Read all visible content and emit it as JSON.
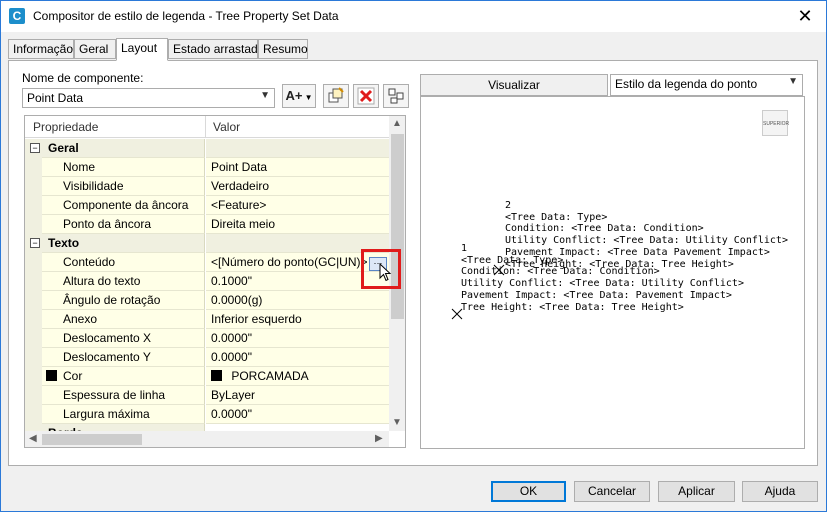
{
  "window": {
    "app_icon": "C",
    "title": "Compositor de estilo de legenda - Tree Property Set Data"
  },
  "tabs": [
    {
      "label": "Informação"
    },
    {
      "label": "Geral"
    },
    {
      "label": "Layout"
    },
    {
      "label": "Estado arrastado"
    },
    {
      "label": "Resumo"
    }
  ],
  "component": {
    "label": "Nome de componente:",
    "value": "Point Data"
  },
  "toolbar": {
    "add_text_icon": "A+",
    "copy_icon": "copy-icon",
    "delete_icon": "delete-icon",
    "order_icon": "order-icon"
  },
  "grid": {
    "col_property": "Propriedade",
    "col_value": "Valor",
    "rows": [
      {
        "type": "cat",
        "name": "Geral",
        "value": ""
      },
      {
        "type": "prop",
        "name": "Nome",
        "value": "Point Data"
      },
      {
        "type": "prop",
        "name": "Visibilidade",
        "value": "Verdadeiro"
      },
      {
        "type": "prop",
        "name": "Componente da âncora",
        "value": "<Feature>"
      },
      {
        "type": "prop",
        "name": "Ponto da âncora",
        "value": "Direita meio"
      },
      {
        "type": "cat",
        "name": "Texto",
        "value": ""
      },
      {
        "type": "prop",
        "name": "Conteúdo",
        "value": "<[Número do ponto(GC|UN)>"
      },
      {
        "type": "prop",
        "name": "Altura do texto",
        "value": "0.1000\""
      },
      {
        "type": "prop",
        "name": "Ângulo de rotação",
        "value": "0.0000(g)"
      },
      {
        "type": "prop",
        "name": "Anexo",
        "value": "Inferior esquerdo"
      },
      {
        "type": "prop",
        "name": "Deslocamento X",
        "value": "0.0000\""
      },
      {
        "type": "prop",
        "name": "Deslocamento Y",
        "value": "0.0000\""
      },
      {
        "type": "prop",
        "name": "Cor",
        "value": "PORCAMADA"
      },
      {
        "type": "prop",
        "name": "Espessura de linha",
        "value": "ByLayer"
      },
      {
        "type": "prop",
        "name": "Largura máxima",
        "value": "0.0000\""
      },
      {
        "type": "cat",
        "name": "Borda",
        "value": ""
      }
    ]
  },
  "preview": {
    "tab_label": "Visualizar",
    "style_select": "Estilo da legenda do ponto",
    "thumb_text": "SUPERIOR",
    "block1": "2\n<Tree Data: Type>\nCondition: <Tree Data: Condition>\nUtility Conflict: <Tree Data: Utility Conflict>\nPavement Impact: <Tree Data Pavement Impact>\n<Tree Height: <Tree Data: Tree Height>",
    "block2": "1\n<Tree Data: Type>\nCondition: <Tree Data: Condition>\nUtility Conflict: <Tree Data: Utility Conflict>\nPavement Impact: <Tree Data: Pavement Impact>\nTree Height: <Tree Data: Tree Height>"
  },
  "buttons": {
    "ok": "OK",
    "cancel": "Cancelar",
    "apply": "Aplicar",
    "help": "Ajuda"
  },
  "colors": {
    "highlight": "#e01b1b",
    "grid_bg": "#ffffe7",
    "accent": "#0078d7"
  }
}
